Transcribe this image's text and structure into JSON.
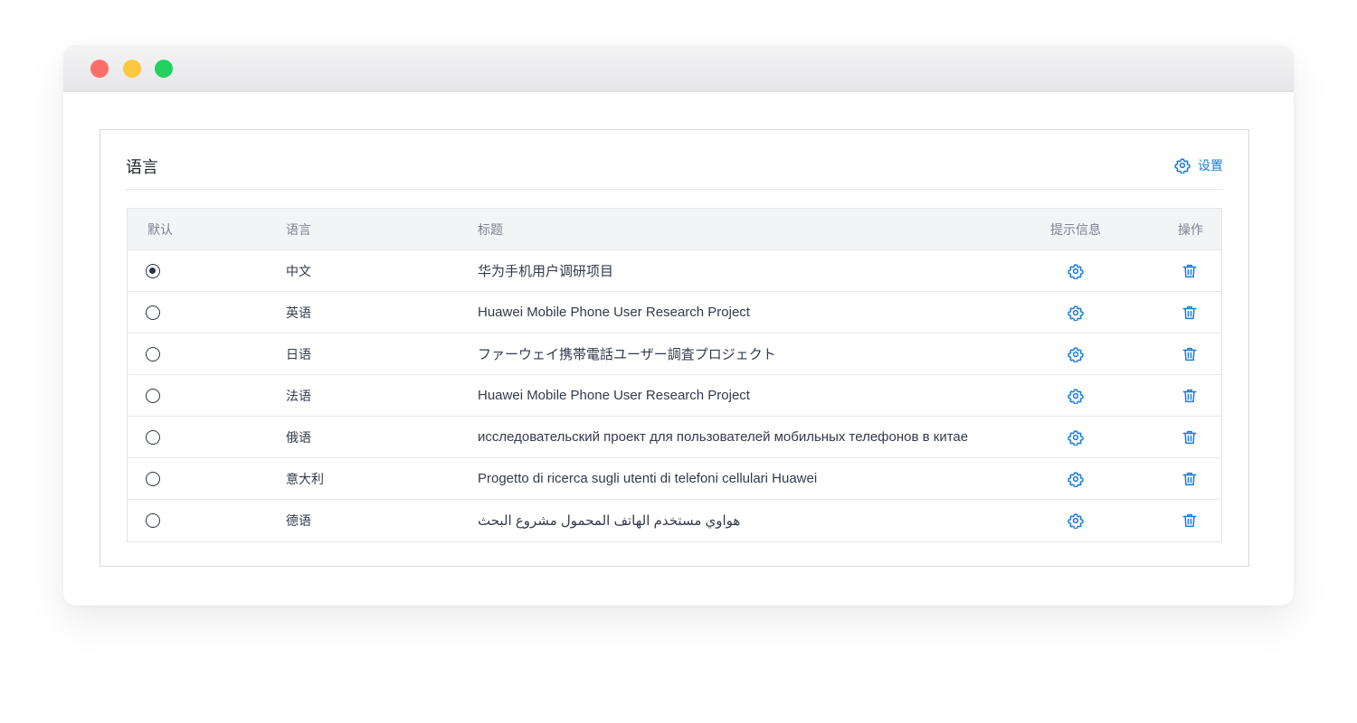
{
  "panel": {
    "title": "语言",
    "settings_label": "设置"
  },
  "table": {
    "headers": {
      "default": "默认",
      "language": "语言",
      "title": "标题",
      "tip": "提示信息",
      "action": "操作"
    },
    "rows": [
      {
        "checked": true,
        "language": "中文",
        "title": "华为手机用户调研项目"
      },
      {
        "checked": false,
        "language": "英语",
        "title": "Huawei Mobile Phone User Research Project"
      },
      {
        "checked": false,
        "language": "日语",
        "title": "ファーウェイ携帯電話ユーザー調査プロジェクト"
      },
      {
        "checked": false,
        "language": "法语",
        "title": "Huawei Mobile Phone User Research Project"
      },
      {
        "checked": false,
        "language": "俄语",
        "title": "исследовательский проект для пользователей мобильных телефонов в китае"
      },
      {
        "checked": false,
        "language": "意大利",
        "title": "Progetto di ricerca sugli utenti di telefoni cellulari Huawei"
      },
      {
        "checked": false,
        "language": "德语",
        "title": "هواوي مستخدم الهاتف المحمول مشروع البحث"
      }
    ]
  },
  "colors": {
    "accent": "#1a7cdc",
    "header_bg": "#f3f4f6",
    "text": "#333a4d"
  },
  "icons": {
    "settings": "gear-icon",
    "delete": "trash-icon"
  }
}
